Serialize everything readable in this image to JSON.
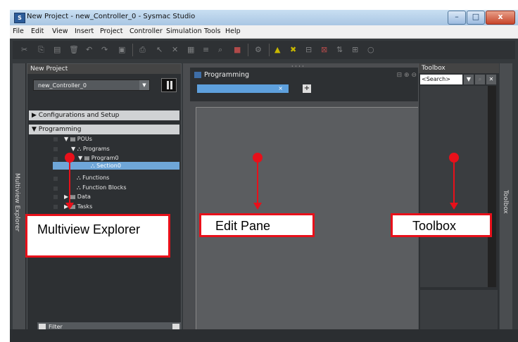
{
  "window": {
    "title": "New Project - new_Controller_0 - Sysmac Studio",
    "app_icon": "S",
    "controls": {
      "minimize": "–",
      "maximize": "□",
      "close": "x"
    }
  },
  "menu": {
    "items": [
      "File",
      "Edit",
      "View",
      "Insert",
      "Project",
      "Controller",
      "Simulation",
      "Tools",
      "Help"
    ]
  },
  "toolbar": {
    "icons": [
      "cut-icon",
      "copy-icon",
      "paste-icon",
      "delete-icon",
      "undo-icon",
      "redo-icon",
      "save-icon",
      "print-icon",
      "pointer-icon",
      "cross-ref-icon",
      "grid-icon",
      "align-icon",
      "find-icon",
      "stop-icon",
      "build-icon",
      "warning-icon",
      "online-icon",
      "tool-a-icon",
      "tool-b-icon",
      "tool-c-icon",
      "tool-d-icon",
      "circle-icon"
    ]
  },
  "explorer": {
    "header": "New Project",
    "controller": "new_Controller_0",
    "sections": {
      "config": "Configurations and Setup",
      "programming": "Programming"
    },
    "tree": {
      "pous": "POUs",
      "programs": "Programs",
      "program0": "Program0",
      "section0": "Section0",
      "functions": "Functions",
      "function_blocks": "Function Blocks",
      "data": "Data",
      "tasks": "Tasks"
    },
    "filter_label": "Filter",
    "side_label": "Multiview Explorer"
  },
  "edit": {
    "title": "Programming",
    "tab_close": "×",
    "add_tab": "+",
    "grip": "· · · ·"
  },
  "toolbox": {
    "header": "Toolbox",
    "search_placeholder": "<Search>",
    "side_label": "Toolbox"
  },
  "callouts": {
    "explorer": "Multiview Explorer",
    "edit": "Edit Pane",
    "toolbox": "Toolbox"
  },
  "colors": {
    "callout": "#e8101a",
    "selection": "#6fa6d8",
    "tab": "#5ea0dd"
  }
}
